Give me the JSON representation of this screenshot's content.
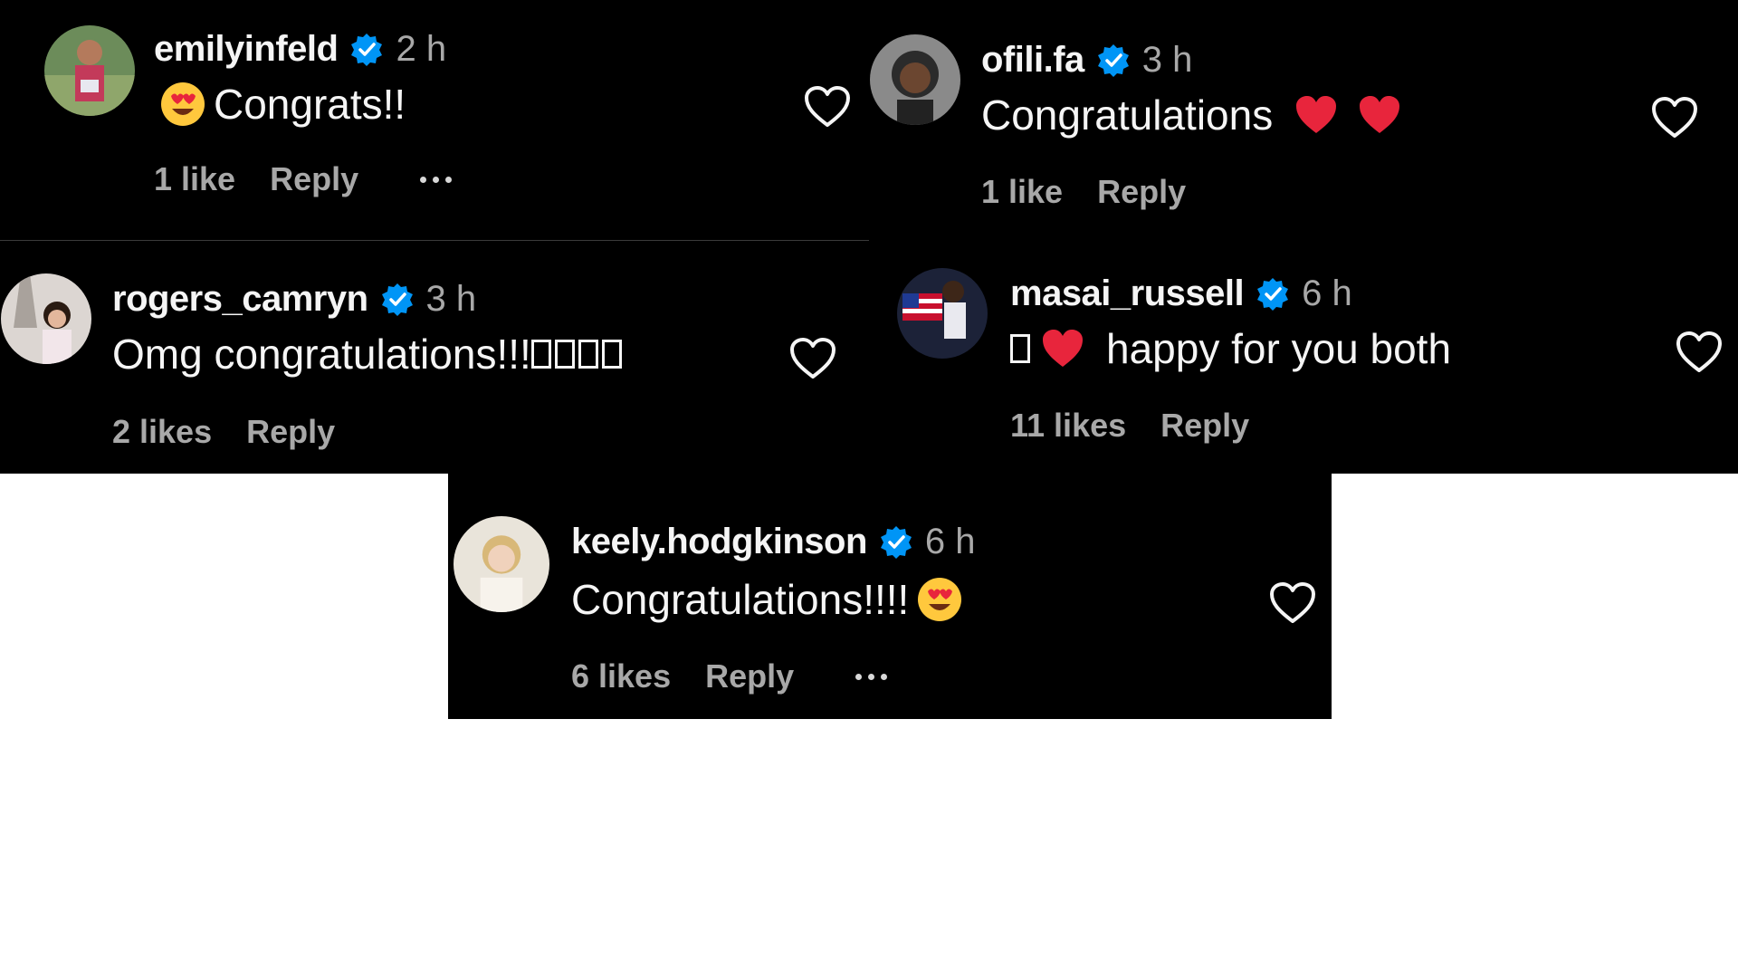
{
  "comments": [
    {
      "username": "emilyinfeld",
      "time": "2 h",
      "text": "Congrats!!",
      "emoji_before": "heart-eyes-emoji",
      "likes": "1 like",
      "reply_label": "Reply",
      "has_more": true
    },
    {
      "username": "ofili.fa",
      "time": "3 h",
      "text": "Congratulations",
      "emoji_after": [
        "red-heart-emoji",
        "red-heart-emoji"
      ],
      "likes": "1 like",
      "reply_label": "Reply"
    },
    {
      "username": "rogers_camryn",
      "time": "3 h",
      "text": "Omg congratulations!!!",
      "glyph_boxes": 4,
      "likes": "2 likes",
      "reply_label": "Reply"
    },
    {
      "username": "masai_russell",
      "time": "6 h",
      "text": "happy for you both",
      "glyph_boxes": 1,
      "emoji_before": "red-heart-emoji",
      "likes": "11 likes",
      "reply_label": "Reply"
    },
    {
      "username": "keely.hodgkinson",
      "time": "6 h",
      "text": "Congratulations!!!!",
      "emoji_after": [
        "heart-eyes-emoji"
      ],
      "likes": "6 likes",
      "reply_label": "Reply",
      "has_more": true
    }
  ],
  "icons": {
    "verified": "verified-badge-icon",
    "like": "heart-outline-icon",
    "more": "more-options-icon"
  },
  "colors": {
    "background": "#000000",
    "username": "#f5f5f5",
    "secondary_text": "#a8a8a8",
    "verified_blue": "#0095f6",
    "heart_red": "#e0245e"
  }
}
